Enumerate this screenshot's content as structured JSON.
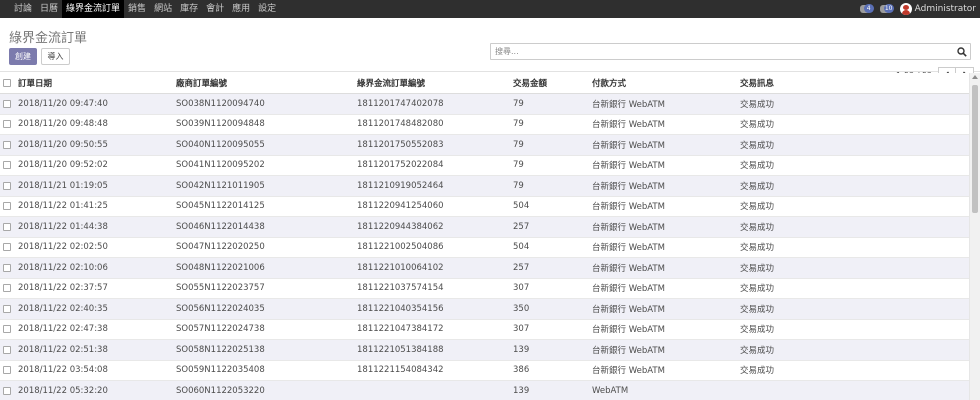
{
  "nav": {
    "menu": [
      "討論",
      "日曆",
      "綠界金流訂單",
      "銷售",
      "網站",
      "庫存",
      "會計",
      "應用",
      "設定"
    ],
    "active_index": 2,
    "chat_badge": "4",
    "activity_badge": "10",
    "user_name": "Administrator"
  },
  "control": {
    "title": "綠界金流訂單",
    "create_label": "創建",
    "import_label": "導入",
    "search_placeholder": "搜尋...",
    "pager_text": "1-52 / 52"
  },
  "table": {
    "headers": [
      "訂單日期",
      "廠商訂單編號",
      "綠界金流訂單編號",
      "交易金額",
      "付款方式",
      "交易訊息"
    ],
    "rows": [
      [
        "2018/11/20 09:47:40",
        "SO038N1120094740",
        "1811201747402078",
        "79",
        "台新銀行 WebATM",
        "交易成功"
      ],
      [
        "2018/11/20 09:48:48",
        "SO039N1120094848",
        "1811201748482080",
        "79",
        "台新銀行 WebATM",
        "交易成功"
      ],
      [
        "2018/11/20 09:50:55",
        "SO040N1120095055",
        "1811201750552083",
        "79",
        "台新銀行 WebATM",
        "交易成功"
      ],
      [
        "2018/11/20 09:52:02",
        "SO041N1120095202",
        "1811201752022084",
        "79",
        "台新銀行 WebATM",
        "交易成功"
      ],
      [
        "2018/11/21 01:19:05",
        "SO042N1121011905",
        "1811210919052464",
        "79",
        "台新銀行 WebATM",
        "交易成功"
      ],
      [
        "2018/11/22 01:41:25",
        "SO045N1122014125",
        "1811220941254060",
        "504",
        "台新銀行 WebATM",
        "交易成功"
      ],
      [
        "2018/11/22 01:44:38",
        "SO046N1122014438",
        "1811220944384062",
        "257",
        "台新銀行 WebATM",
        "交易成功"
      ],
      [
        "2018/11/22 02:02:50",
        "SO047N1122020250",
        "1811221002504086",
        "504",
        "台新銀行 WebATM",
        "交易成功"
      ],
      [
        "2018/11/22 02:10:06",
        "SO048N1122021006",
        "1811221010064102",
        "257",
        "台新銀行 WebATM",
        "交易成功"
      ],
      [
        "2018/11/22 02:37:57",
        "SO055N1122023757",
        "1811221037574154",
        "307",
        "台新銀行 WebATM",
        "交易成功"
      ],
      [
        "2018/11/22 02:40:35",
        "SO056N1122024035",
        "1811221040354156",
        "350",
        "台新銀行 WebATM",
        "交易成功"
      ],
      [
        "2018/11/22 02:47:38",
        "SO057N1122024738",
        "1811221047384172",
        "307",
        "台新銀行 WebATM",
        "交易成功"
      ],
      [
        "2018/11/22 02:51:38",
        "SO058N1122025138",
        "1811221051384188",
        "139",
        "台新銀行 WebATM",
        "交易成功"
      ],
      [
        "2018/11/22 03:54:08",
        "SO059N1122035408",
        "1811221154084342",
        "386",
        "台新銀行 WebATM",
        "交易成功"
      ],
      [
        "2018/11/22 05:32:20",
        "SO060N1122053220",
        "",
        "139",
        "WebATM",
        ""
      ]
    ]
  },
  "colors": {
    "navbar": "#2f2f2f",
    "primary": "#7c7bad",
    "row_stripe": "#f0f0f7"
  }
}
